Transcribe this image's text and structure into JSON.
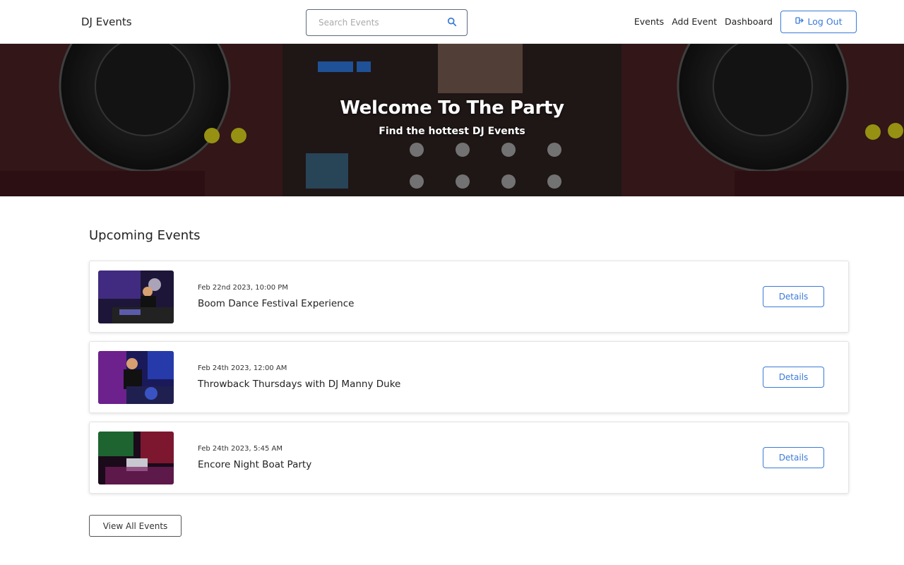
{
  "header": {
    "logo": "DJ Events",
    "search_placeholder": "Search Events",
    "nav": [
      "Events",
      "Add Event",
      "Dashboard"
    ],
    "logout_label": "Log Out"
  },
  "hero": {
    "title": "Welcome To The Party",
    "subtitle": "Find the hottest DJ Events"
  },
  "main": {
    "section_title": "Upcoming Events",
    "events": [
      {
        "date": "Feb 22nd 2023, 10:00 PM",
        "name": "Boom Dance Festival Experience",
        "details_label": "Details"
      },
      {
        "date": "Feb 24th 2023, 12:00 AM",
        "name": "Throwback Thursdays with DJ Manny Duke",
        "details_label": "Details"
      },
      {
        "date": "Feb 24th 2023, 5:45 AM",
        "name": "Encore Night Boat Party",
        "details_label": "Details"
      }
    ],
    "view_all_label": "View All Events"
  },
  "colors": {
    "accent": "#3b7bd8",
    "text": "#222222"
  }
}
